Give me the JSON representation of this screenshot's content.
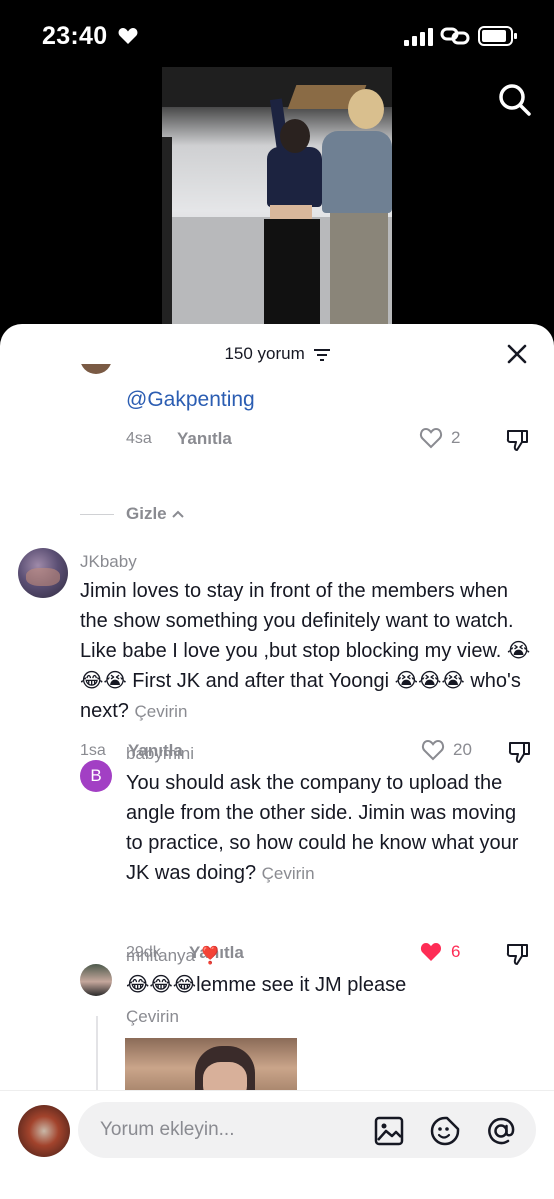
{
  "status_bar": {
    "time": "23:40"
  },
  "sheet": {
    "comment_count": "150 yorum",
    "close_label": "×"
  },
  "comments": {
    "reply1": {
      "mention": "@Gakpenting",
      "time": "4sa",
      "reply_label": "Yanıtla",
      "likes": "2"
    },
    "hide_label": "Gizle",
    "c1": {
      "username": "JKbaby",
      "text": "Jimin loves to stay in front of the members when the show something you definitely want to watch. Like babe I love you ,but stop blocking my view. 😭😂😭 First JK and after that Yoongi 😭😭😭 who's next?",
      "translate": "Çevirin",
      "time": "1sa",
      "reply_label": "Yanıtla",
      "likes": "20"
    },
    "c2": {
      "avatar_letter": "B",
      "username": "babymini",
      "text": "You should ask the company to upload the angle from the other side. Jimin was moving to practice, so how could he know what your JK was doing?",
      "translate": "Çevirin",
      "time": "29dk",
      "reply_label": "Yanıtla",
      "likes": "6",
      "liked_color": "#fe2c55"
    },
    "c3": {
      "username": "mnitanya",
      "username_emoji": "❣️",
      "text": "😂😂😂lemme see it JM please",
      "translate": "Çevirin"
    }
  },
  "bottom_bar": {
    "placeholder": "Yorum ekleyin..."
  },
  "icons": [
    "heart-icon",
    "signal-icon",
    "link-icon",
    "battery-icon",
    "search-icon",
    "filter-icon",
    "close-icon",
    "like-icon",
    "dislike-icon",
    "chevron-up-icon",
    "image-icon",
    "sticker-icon",
    "at-icon"
  ]
}
